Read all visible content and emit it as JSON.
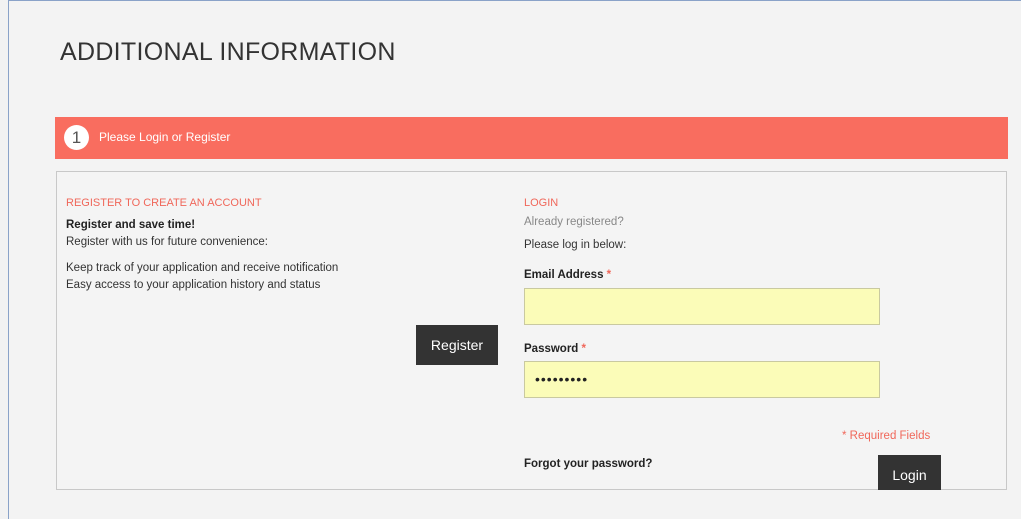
{
  "page": {
    "title": "ADDITIONAL INFORMATION"
  },
  "step": {
    "number": "1",
    "label": "Please Login or Register"
  },
  "register": {
    "heading": "REGISTER TO CREATE AN ACCOUNT",
    "subtitle": "Register and save time!",
    "line1": "Register with us for future convenience:",
    "benefit1": "Keep track of your application and receive notification",
    "benefit2": "Easy access to your application history and status",
    "button": "Register"
  },
  "login": {
    "heading": "LOGIN",
    "already": "Already registered?",
    "prompt": "Please log in below:",
    "email_label": "Email Address",
    "email_value": "",
    "password_label": "Password",
    "password_value": "•••••••••",
    "required_marker": "*",
    "required_note": "* Required Fields",
    "forgot": "Forgot your password?",
    "button": "Login"
  },
  "colors": {
    "accent": "#f96d5f",
    "field_bg": "#fbfcb8",
    "button_bg": "#333333"
  }
}
